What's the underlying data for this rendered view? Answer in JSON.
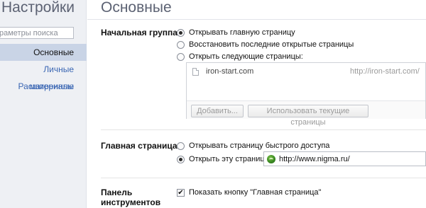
{
  "sidebar": {
    "title": "Настройки",
    "search_placeholder": "раметры поиска",
    "items": [
      {
        "label": "Основные",
        "active": true
      },
      {
        "label": "Личные материалы",
        "active": false
      },
      {
        "label": "Расширенные",
        "active": false
      }
    ]
  },
  "main": {
    "title": "Основные",
    "startup": {
      "label": "Начальная группа",
      "options": [
        {
          "label": "Открывать главную страницу",
          "checked": true
        },
        {
          "label": "Восстановить последние открытые страницы",
          "checked": false
        },
        {
          "label": "Открыть следующие страницы:",
          "checked": false
        }
      ],
      "pages": [
        {
          "name": "iron-start.com",
          "url": "http://iron-start.com/"
        }
      ],
      "add_button": "Добавить...",
      "use_current_button": "Использовать текущие страницы"
    },
    "homepage": {
      "label": "Главная страница",
      "options": [
        {
          "label": "Открывать страницу быстрого доступа",
          "checked": false
        },
        {
          "label": "Открыть эту страницу:",
          "checked": true
        }
      ],
      "url_value": "http://www.nigma.ru/",
      "url_icon": "nigma-favicon-icon"
    },
    "toolbar": {
      "label_line1": "Панель",
      "label_line2": "инструментов",
      "show_home_button": {
        "label": "Показать кнопку \"Главная страница\"",
        "checked": true
      }
    }
  }
}
